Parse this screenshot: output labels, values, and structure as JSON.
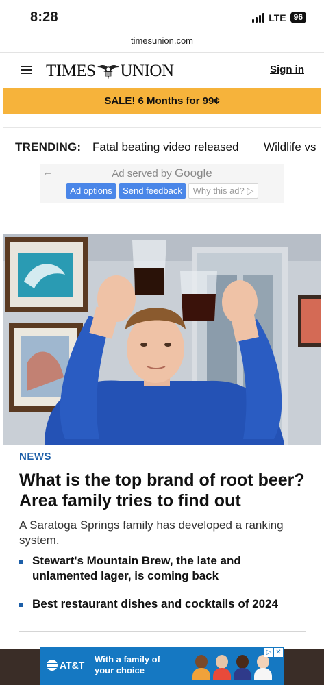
{
  "status_bar": {
    "time": "8:28",
    "network": "LTE",
    "battery": "96"
  },
  "browser": {
    "url": "timesunion.com"
  },
  "header": {
    "logo_left": "TIMES",
    "logo_right": "UNION",
    "signin_label": "Sign in",
    "menu_icon": "hamburger-icon"
  },
  "promo": {
    "text": "SALE! 6 Months for 99¢"
  },
  "trending": {
    "label": "TRENDING:",
    "items": [
      "Fatal beating video released",
      "Wildlife vs"
    ]
  },
  "ad_notice": {
    "served_prefix": "Ad served by",
    "served_brand": "Google",
    "options_label": "Ad options",
    "feedback_label": "Send feedback",
    "why_label": "Why this ad?"
  },
  "article": {
    "section": "NEWS",
    "headline": "What is the top brand of root beer? Area family tries to find out",
    "dek": "A Saratoga Springs family has developed a ranking system.",
    "related": [
      "Stewart's Mountain Brew, the late and unlamented lager, is coming back",
      "Best restaurant dishes and cocktails of 2024"
    ]
  },
  "banner_ad": {
    "brand": "AT&T",
    "copy": "With a family of your choice"
  },
  "colors": {
    "promo_bg": "#f6b33b",
    "accent_blue": "#1c5ea8",
    "ad_button": "#4a86e8",
    "banner_bg": "#1578c2"
  }
}
